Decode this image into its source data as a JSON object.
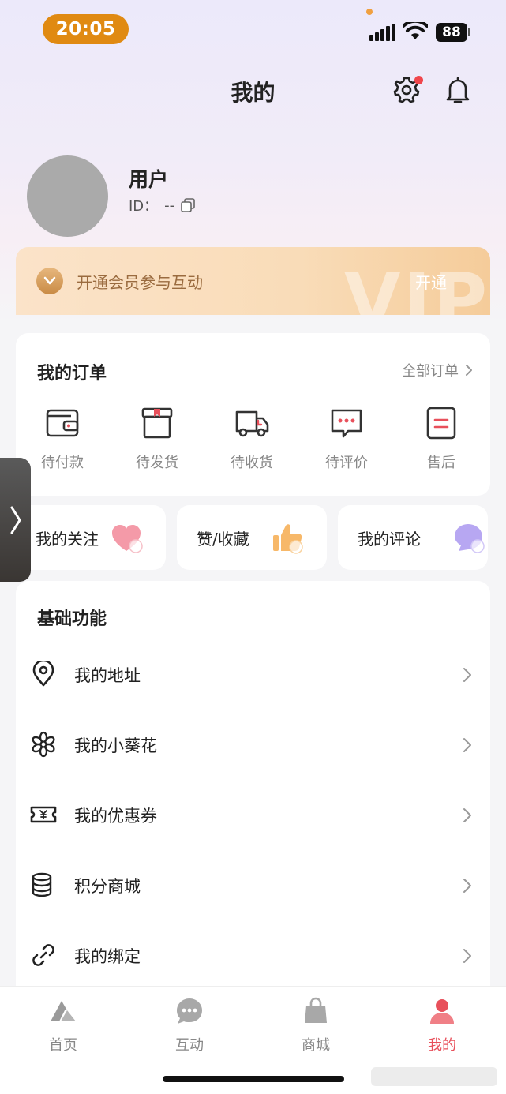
{
  "status_bar": {
    "time": "20:05",
    "battery": "88"
  },
  "header": {
    "title": "我的"
  },
  "profile": {
    "name": "用户",
    "id_label": "ID：",
    "id_value": "--"
  },
  "vip": {
    "text": "开通会员参与互动",
    "watermark": "VIP",
    "button": "开通"
  },
  "orders": {
    "title": "我的订单",
    "all_label": "全部订单",
    "items": [
      {
        "label": "待付款",
        "icon": "wallet-icon"
      },
      {
        "label": "待发货",
        "icon": "box-icon"
      },
      {
        "label": "待收货",
        "icon": "truck-icon"
      },
      {
        "label": "待评价",
        "icon": "comment-icon"
      },
      {
        "label": "售后",
        "icon": "aftersale-icon"
      }
    ]
  },
  "shortcuts": [
    {
      "label": "我的关注",
      "icon": "heart-icon"
    },
    {
      "label": "赞/收藏",
      "icon": "thumbs-up-icon"
    },
    {
      "label": "我的评论",
      "icon": "chat-bubble-icon"
    }
  ],
  "functions": {
    "title": "基础功能",
    "items": [
      {
        "label": "我的地址",
        "icon": "location-pin-icon"
      },
      {
        "label": "我的小葵花",
        "icon": "flower-icon"
      },
      {
        "label": "我的优惠券",
        "icon": "coupon-icon"
      },
      {
        "label": "积分商城",
        "icon": "coins-stack-icon"
      },
      {
        "label": "我的绑定",
        "icon": "link-icon"
      }
    ]
  },
  "tabbar": {
    "items": [
      {
        "label": "首页",
        "icon": "home-mountain-icon",
        "active": false
      },
      {
        "label": "互动",
        "icon": "chat-dots-icon",
        "active": false
      },
      {
        "label": "商城",
        "icon": "shopping-bag-icon",
        "active": false
      },
      {
        "label": "我的",
        "icon": "person-icon",
        "active": true
      }
    ]
  },
  "colors": {
    "accent": "#e8505b",
    "time_pill": "#e08a12",
    "vip_text": "#9a6b3f"
  }
}
